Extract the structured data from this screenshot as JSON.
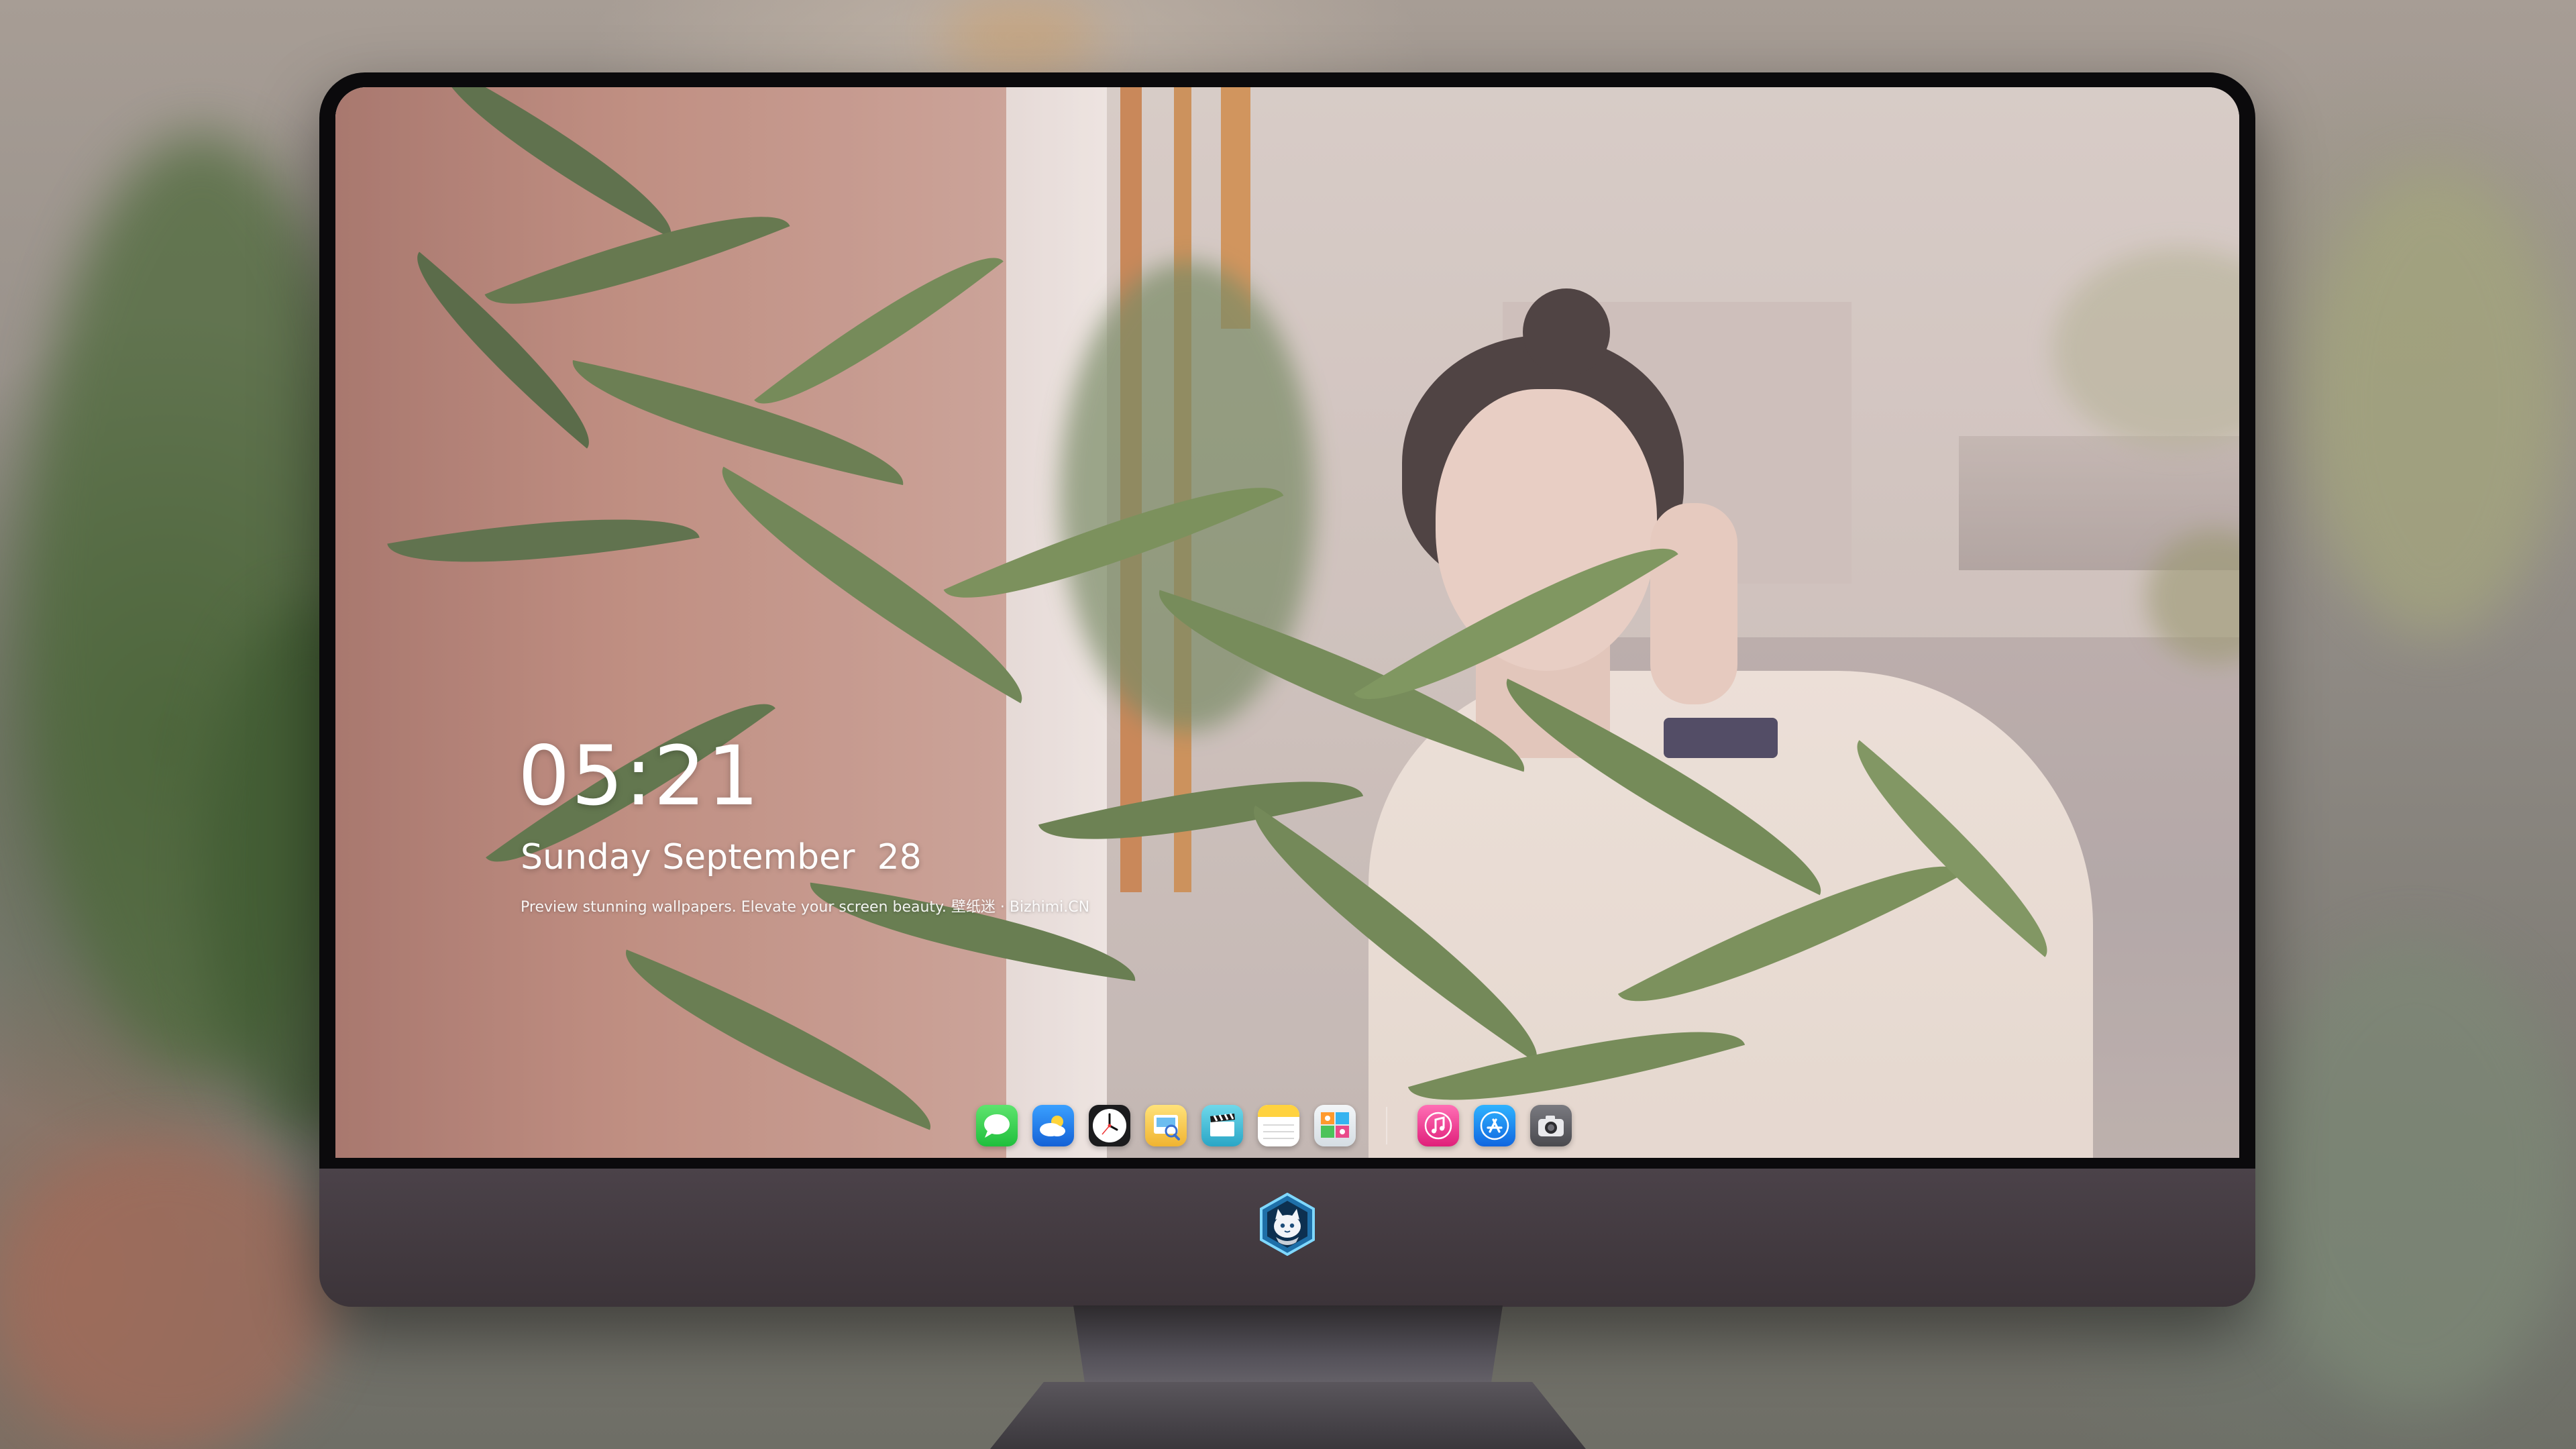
{
  "lockscreen": {
    "time": "05:21",
    "date": "Sunday September  28",
    "tagline": "Preview stunning wallpapers. Elevate your screen beauty. 壁纸迷 · Bizhimi.CN"
  },
  "dock": {
    "apps": [
      {
        "name": "Messages",
        "icon": "messages-icon",
        "color": "#34c759"
      },
      {
        "name": "Weather",
        "icon": "weather-icon",
        "color": "#1e90ff"
      },
      {
        "name": "Clock",
        "icon": "clock-icon",
        "color": "#ffffff"
      },
      {
        "name": "Preview",
        "icon": "preview-icon",
        "color": "#f4c542"
      },
      {
        "name": "Clips",
        "icon": "clapperboard-icon",
        "color": "#45c1d8"
      },
      {
        "name": "Notes",
        "icon": "notes-icon",
        "color": "#ffd84d"
      },
      {
        "name": "Photo Booth",
        "icon": "photo-booth-icon",
        "color": "#e8eef2"
      },
      {
        "name": "Music",
        "icon": "music-icon",
        "color": "#fc3c8d"
      },
      {
        "name": "App Store",
        "icon": "app-store-icon",
        "color": "#1f8ef1"
      },
      {
        "name": "Camera",
        "icon": "camera-icon",
        "color": "#5a5a5e"
      }
    ]
  },
  "monitor": {
    "logo_icon": "cat-mascot-logo-icon"
  }
}
